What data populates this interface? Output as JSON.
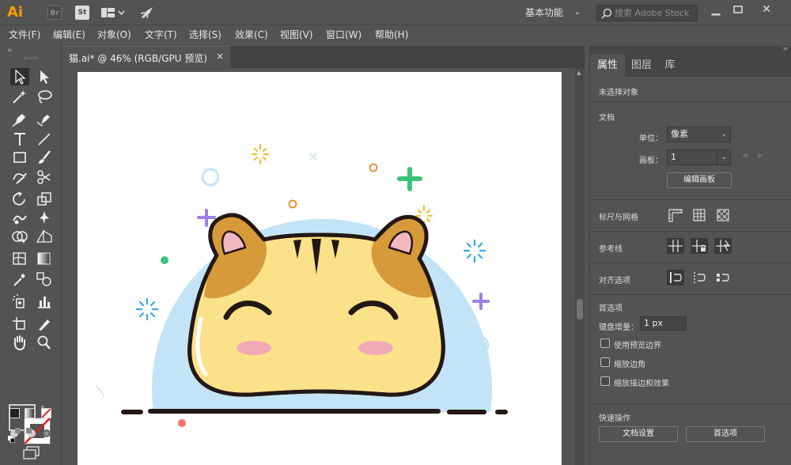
{
  "app": {
    "logo": "Ai",
    "bridge_icon": "Br",
    "stock_icon": "St",
    "workspace": "基本功能",
    "search_placeholder": "搜索 Adobe Stock",
    "window_buttons": [
      "minimize-icon",
      "restore-icon",
      "close-icon"
    ]
  },
  "menu": [
    "文件(F)",
    "编辑(E)",
    "对象(O)",
    "文字(T)",
    "选择(S)",
    "效果(C)",
    "视图(V)",
    "窗口(W)",
    "帮助(H)"
  ],
  "document": {
    "tab_title": "猫.ai* @ 46% (RGB/GPU 预览)",
    "close_glyph": "×"
  },
  "tools": [
    "selection-tool-icon",
    "direct-selection-tool-icon",
    "magic-wand-tool-icon",
    "lasso-tool-icon",
    "pen-tool-icon",
    "curvature-tool-icon",
    "type-tool-icon",
    "line-segment-tool-icon",
    "rectangle-tool-icon",
    "paintbrush-tool-icon",
    "shaper-tool-icon",
    "scissors-tool-icon",
    "rotate-tool-icon",
    "scale-tool-icon",
    "warp-tool-icon",
    "puppet-warp-tool-icon",
    "shape-builder-tool-icon",
    "perspective-grid-tool-icon",
    "mesh-tool-icon",
    "gradient-tool-icon",
    "eyedropper-tool-icon",
    "blend-tool-icon",
    "symbol-sprayer-tool-icon",
    "column-graph-tool-icon",
    "artboard-tool-icon",
    "slice-tool-icon",
    "hand-tool-icon",
    "zoom-tool-icon"
  ],
  "colors": {
    "fill": "#4d5356",
    "ui_background": "#535353",
    "accent_logo": "#ff9a00",
    "cat_yellow": "#fbe28a",
    "cat_brown": "#d69a3a",
    "sky_blue": "#c3e4f7",
    "outline": "#231815"
  },
  "panel": {
    "tabs": [
      "属性",
      "图层",
      "库"
    ],
    "active_tab": "属性",
    "no_selection": "未选择对象",
    "document_section": "文档",
    "unit_label": "单位：",
    "unit_value": "像素",
    "artboard_label": "画板：",
    "artboard_value": "1",
    "edit_artboards": "编辑画板",
    "rulers_grids": "标尺与网格",
    "guides": "参考线",
    "align_options": "对齐选项",
    "preferences": "首选项",
    "keyboard_increment_label": "键盘增量：",
    "keyboard_increment_value": "1 px",
    "checkboxes": [
      "使用预览边界",
      "缩放边角",
      "缩放描边和效果"
    ],
    "quick_actions": "快速操作",
    "document_setup": "文档设置",
    "preferences_button": "首选项"
  }
}
